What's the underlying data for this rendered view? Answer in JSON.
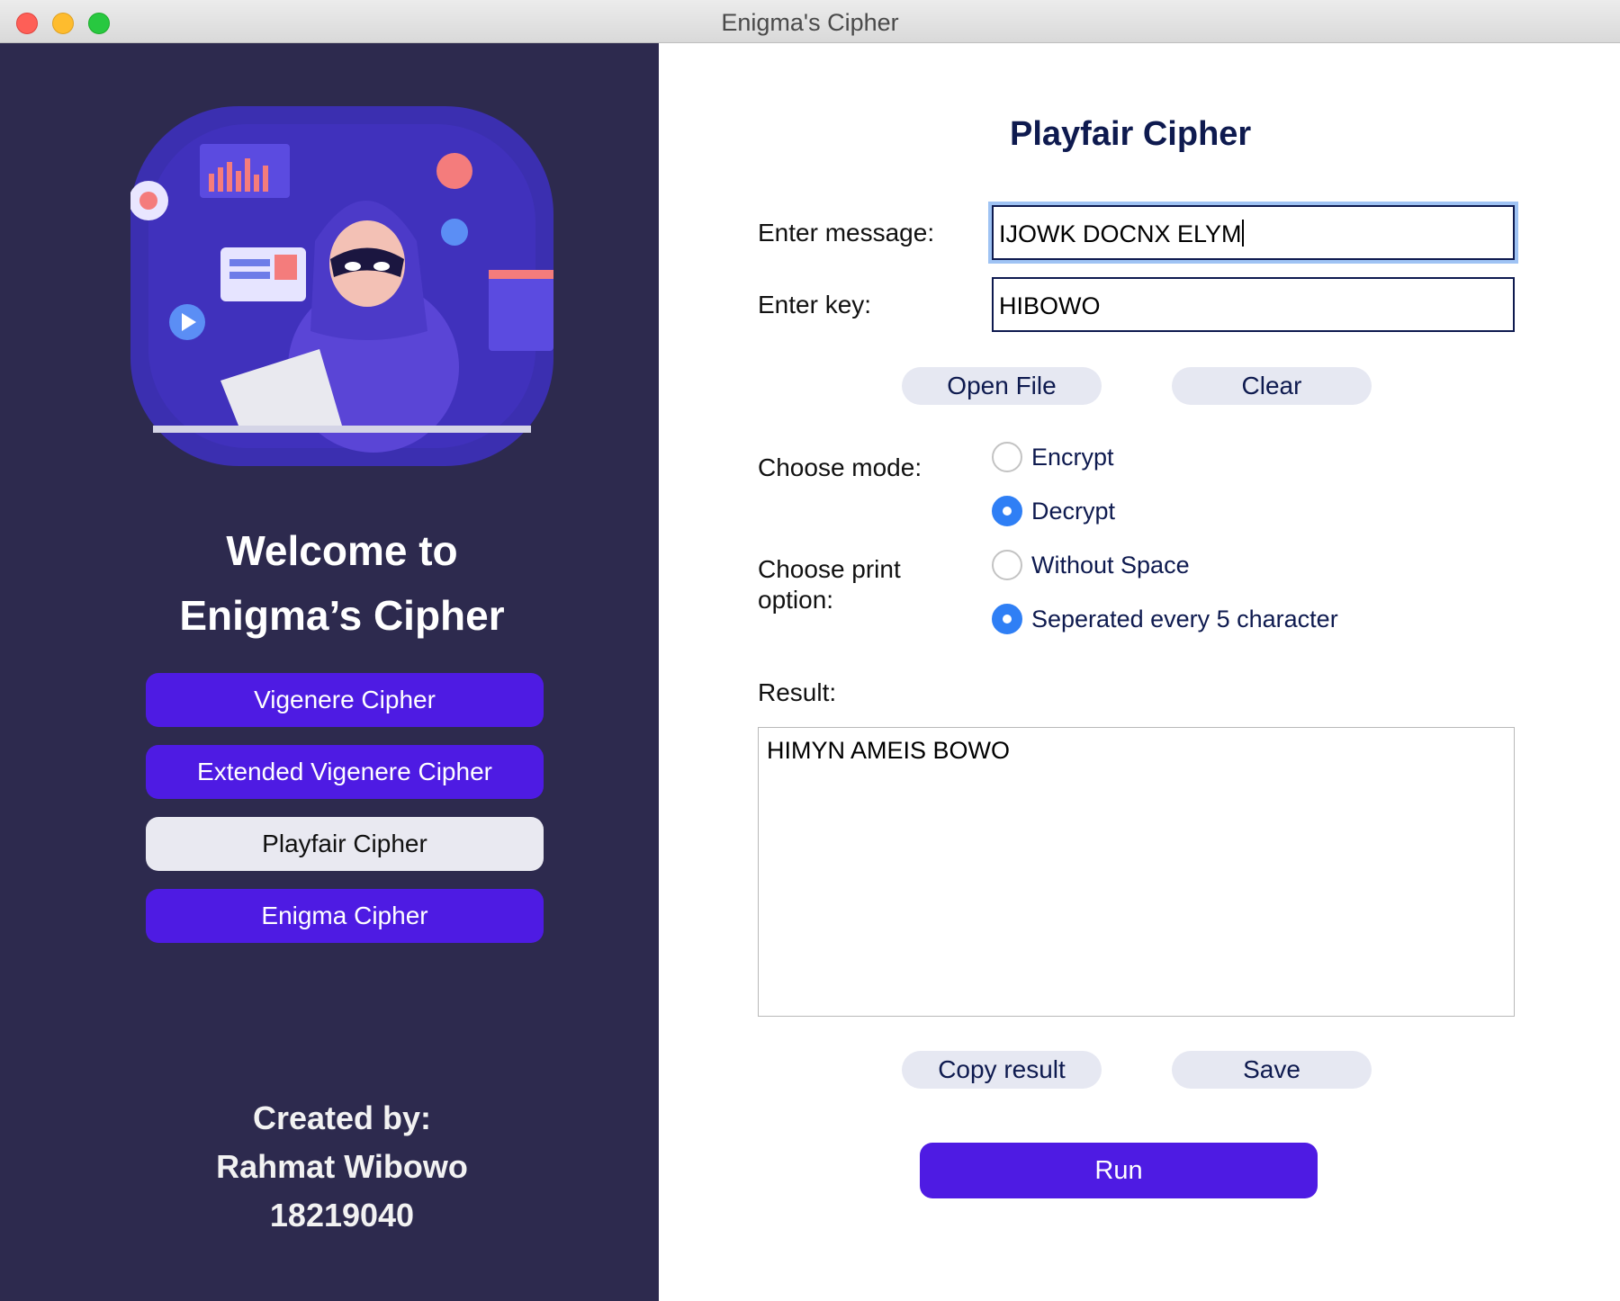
{
  "window": {
    "title": "Enigma's Cipher"
  },
  "sidebar": {
    "welcome_line1": "Welcome to",
    "welcome_line2": "Enigma’s Cipher",
    "nav": [
      {
        "label": "Vigenere Cipher"
      },
      {
        "label": "Extended Vigenere Cipher"
      },
      {
        "label": "Playfair Cipher",
        "active": true
      },
      {
        "label": "Enigma Cipher"
      }
    ],
    "credit_label": "Created by:",
    "credit_name": "Rahmat Wibowo",
    "credit_id": "18219040"
  },
  "main": {
    "title": "Playfair Cipher",
    "message_label": "Enter message:",
    "message_value": "IJOWK DOCNX ELYM",
    "key_label": "Enter key:",
    "key_value": "HIBOWO",
    "open_file_label": "Open File",
    "clear_label": "Clear",
    "mode_label": "Choose mode:",
    "mode_options": [
      {
        "label": "Encrypt",
        "selected": false
      },
      {
        "label": "Decrypt",
        "selected": true
      }
    ],
    "print_label_line1": "Choose print",
    "print_label_line2": "option:",
    "print_options": [
      {
        "label": "Without Space",
        "selected": false
      },
      {
        "label": "Seperated every 5 character",
        "selected": true
      }
    ],
    "result_label": "Result:",
    "result_value": "HIMYN AMEIS BOWO",
    "copy_label": "Copy result",
    "save_label": "Save",
    "run_label": "Run"
  },
  "colors": {
    "sidebar_bg": "#2d2a4e",
    "primary_button": "#4e1be3",
    "active_nav": "#e9e9f1",
    "title_text": "#0e1a4f",
    "radio_selected": "#2f7ff5",
    "pill_bg": "#e6e8f2"
  }
}
